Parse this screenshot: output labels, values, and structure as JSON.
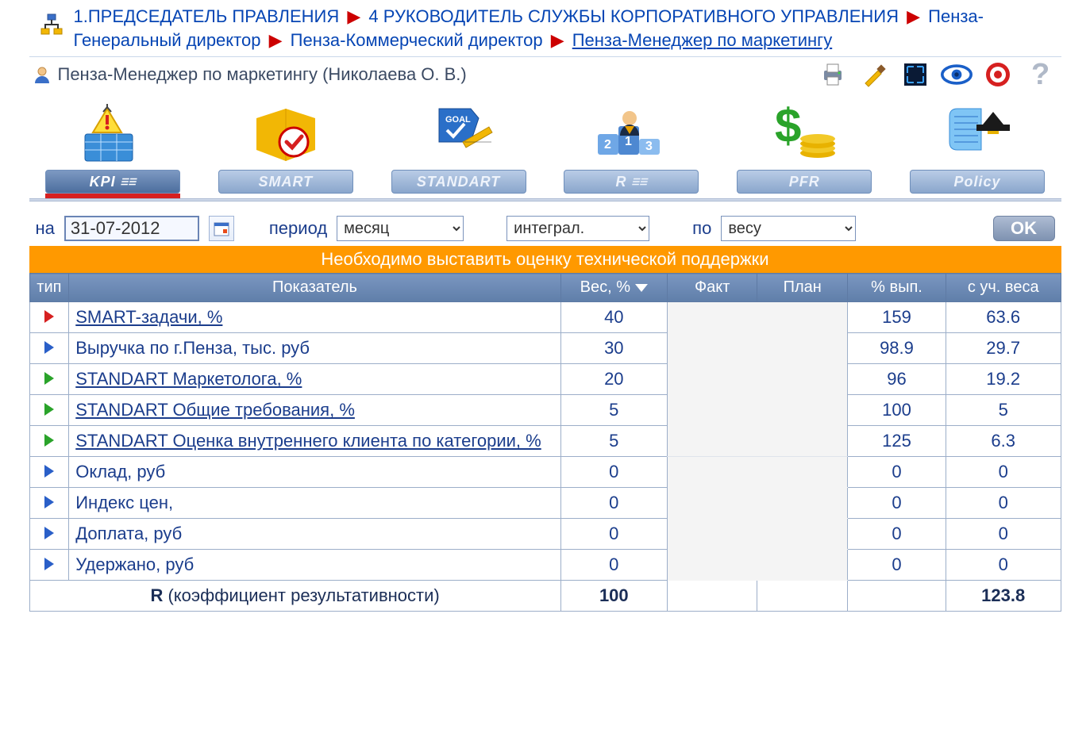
{
  "breadcrumb": {
    "items": [
      "1.ПРЕДСЕДАТЕЛЬ ПРАВЛЕНИЯ",
      "4 РУКОВОДИТЕЛЬ СЛУЖБЫ КОРПОРАТИВНОГО УПРАВЛЕНИЯ",
      "Пенза-Генеральный директор",
      "Пенза-Коммерческий директор",
      "Пенза-Менеджер по маркетингу"
    ]
  },
  "header": {
    "title": "Пенза-Менеджер по маркетингу  (Николаева О. В.)"
  },
  "tabs": [
    {
      "label": "KPI",
      "sub": "☰☰",
      "active": true
    },
    {
      "label": "SMART",
      "sub": "",
      "active": false
    },
    {
      "label": "STANDART",
      "sub": "",
      "active": false
    },
    {
      "label": "R",
      "sub": "☰☰",
      "active": false
    },
    {
      "label": "PFR",
      "sub": "",
      "active": false
    },
    {
      "label": "Policy",
      "sub": "",
      "active": false
    }
  ],
  "filter": {
    "date_label": "на",
    "date_value": "31-07-2012",
    "period_label": "период",
    "period_value": "месяц",
    "integral_value": "интеграл.",
    "by_label": "по",
    "by_value": "весу",
    "ok_label": "OK"
  },
  "banner": "Необходимо выставить оценку технической поддержки",
  "table": {
    "headers": {
      "type": "тип",
      "indicator": "Показатель",
      "weight": "Вес, %",
      "fact": "Факт",
      "plan": "План",
      "pct": "% вып.",
      "wadj": "с уч. веса"
    },
    "rows": [
      {
        "tri": "red",
        "name": "SMART-задачи, %",
        "underline": true,
        "weight": "40",
        "fact": "",
        "plan": "",
        "pct": "159",
        "wadj": "63.6"
      },
      {
        "tri": "blue",
        "name": "Выручка по г.Пенза, тыс. руб",
        "underline": false,
        "weight": "30",
        "fact": "",
        "plan": "",
        "pct": "98.9",
        "wadj": "29.7"
      },
      {
        "tri": "green",
        "name": "STANDART Маркетолога, %",
        "underline": true,
        "weight": "20",
        "fact": "",
        "plan": "",
        "pct": "96",
        "wadj": "19.2"
      },
      {
        "tri": "green",
        "name": "STANDART Общие требования, %",
        "underline": true,
        "weight": "5",
        "fact": "",
        "plan": "",
        "pct": "100",
        "wadj": "5"
      },
      {
        "tri": "green",
        "name": "STANDART Оценка внутреннего клиента по категории, %",
        "underline": true,
        "weight": "5",
        "fact": "",
        "plan": "",
        "pct": "125",
        "wadj": "6.3"
      },
      {
        "tri": "blue",
        "name": "Оклад, руб",
        "underline": false,
        "weight": "0",
        "fact": "",
        "plan": "",
        "pct": "0",
        "wadj": "0"
      },
      {
        "tri": "blue",
        "name": "Индекс цен,",
        "underline": false,
        "weight": "0",
        "fact": "",
        "plan": "",
        "pct": "0",
        "wadj": "0"
      },
      {
        "tri": "blue",
        "name": "Доплата, руб",
        "underline": false,
        "weight": "0",
        "fact": "",
        "plan": "",
        "pct": "0",
        "wadj": "0"
      },
      {
        "tri": "blue",
        "name": "Удержано, руб",
        "underline": false,
        "weight": "0",
        "fact": "",
        "plan": "",
        "pct": "0",
        "wadj": "0"
      }
    ],
    "footer": {
      "label_R": "R",
      "label_desc": " (коэффициент результативности)",
      "weight_total": "100",
      "result": "123.8"
    }
  }
}
